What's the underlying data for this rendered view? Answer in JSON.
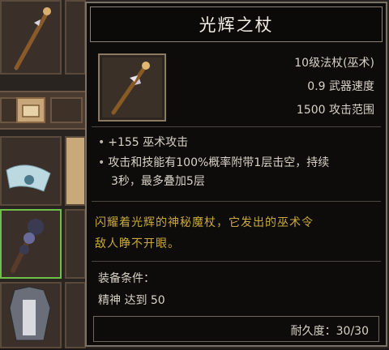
{
  "tooltip": {
    "title": "光辉之杖",
    "stats": {
      "type": "10级法杖(巫术)",
      "speed": "0.9 武器速度",
      "range": "1500 攻击范围"
    },
    "bullets": [
      "+155 巫术攻击",
      "攻击和技能有100%概率附带1层击空，持续",
      "3秒，最多叠加5层"
    ],
    "flavor_lines": [
      "闪耀着光辉的神秘魔杖，它发出的巫术令",
      "敌人睁不开眼。"
    ],
    "requirement_label": "装备条件：",
    "requirement_value": "精神 达到 50",
    "durability": "耐久度：30/30",
    "bullet_dot": "•"
  },
  "colors": {
    "title": "#f2ede4",
    "flavor_gold": "#c9a93c",
    "body_text": "#d8d2c6",
    "selected_slot": "#6ec04a"
  },
  "icons": {
    "tooltip_item": "staff-icon",
    "inventory": [
      "staff-icon",
      "scroll-icon",
      "cloth-icon",
      "spiked-club-icon",
      "armor-icon"
    ]
  }
}
